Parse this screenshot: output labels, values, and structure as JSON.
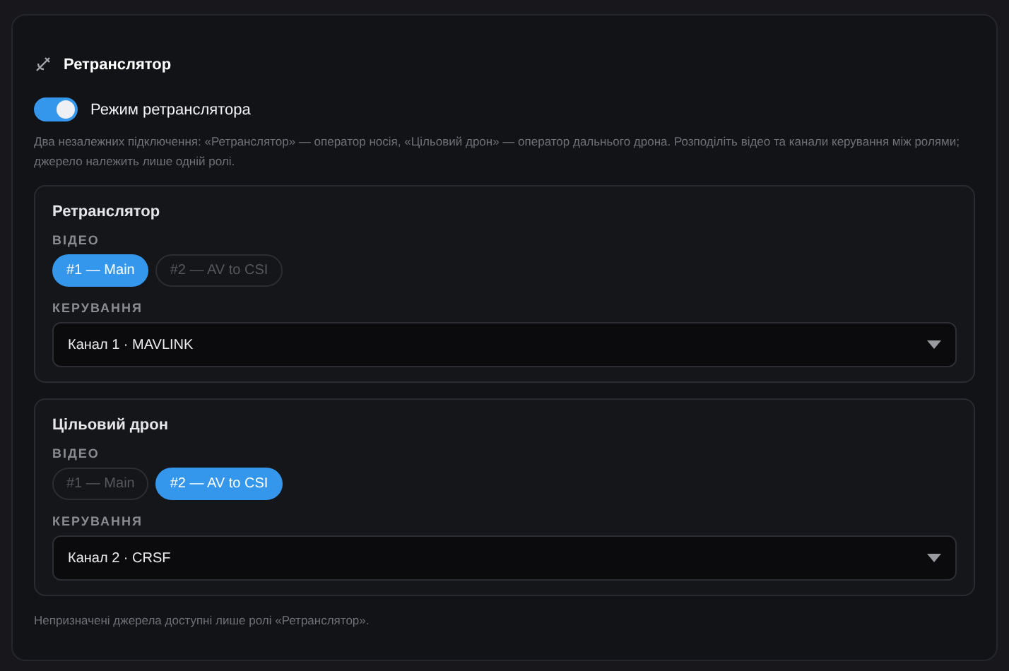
{
  "panel": {
    "title": "Ретранслятор",
    "toggle": {
      "label": "Режим ретранслятора",
      "on": true
    },
    "description": "Два незалежних підключення: «Ретранслятор» — оператор носія, «Цільовий дрон» — оператор дальнього дрона. Розподіліть відео та канали керування між ролями; джерело належить лише одній ролі.",
    "roles": [
      {
        "title": "Ретранслятор",
        "video_label": "ВІДЕО",
        "video_sources": [
          {
            "label": "#1 — Main",
            "selected": true
          },
          {
            "label": "#2 — AV to CSI",
            "selected": false
          }
        ],
        "control_label": "КЕРУВАННЯ",
        "control_value": "Канал 1 · MAVLINK"
      },
      {
        "title": "Цільовий дрон",
        "video_label": "ВІДЕО",
        "video_sources": [
          {
            "label": "#1 — Main",
            "selected": false
          },
          {
            "label": "#2 — AV to CSI",
            "selected": true
          }
        ],
        "control_label": "КЕРУВАННЯ",
        "control_value": "Канал 2 · CRSF"
      }
    ],
    "footer": "Непризначені джерела доступні лише ролі «Ретранслятор»."
  }
}
